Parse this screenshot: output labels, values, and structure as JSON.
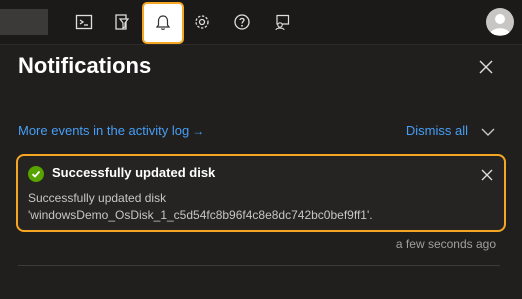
{
  "topbar": {
    "icons": [
      "cloud-shell-icon",
      "directory-filter-icon",
      "bell-icon",
      "gear-icon",
      "help-icon",
      "feedback-icon"
    ],
    "accent": "#f5a623"
  },
  "panel": {
    "title": "Notifications",
    "activity_log_link": "More events in the activity log",
    "dismiss_all": "Dismiss all"
  },
  "notification": {
    "title": "Successfully updated disk",
    "message_line1": "Successfully updated disk",
    "message_line2": "'windowsDemo_OsDisk_1_c5d54fc8b96f4c8e8dc742bc0bef9ff1'.",
    "time": "a few seconds ago",
    "status_color": "#57a300"
  }
}
